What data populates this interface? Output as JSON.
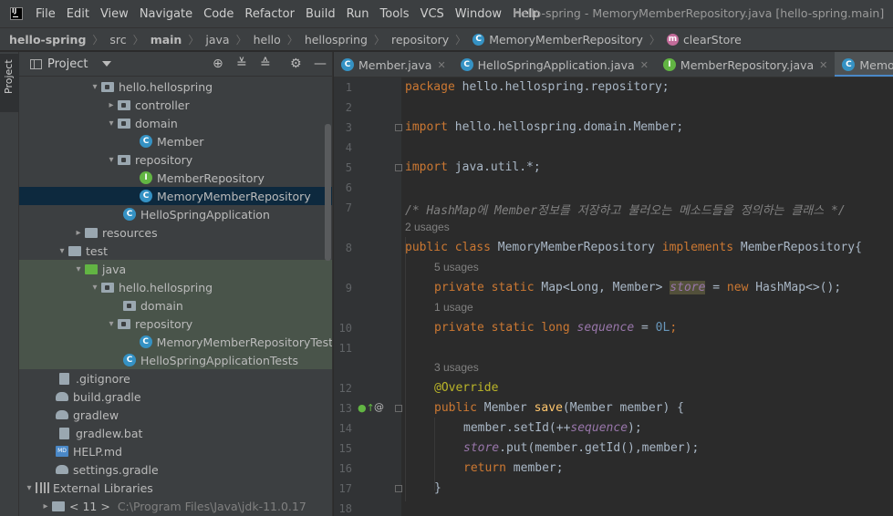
{
  "menu": {
    "items": [
      "File",
      "Edit",
      "View",
      "Navigate",
      "Code",
      "Refactor",
      "Build",
      "Run",
      "Tools",
      "VCS",
      "Window",
      "Help"
    ],
    "window_title": "hello-spring - MemoryMemberRepository.java [hello-spring.main]"
  },
  "breadcrumb": [
    "hello-spring",
    "src",
    "main",
    "java",
    "hello",
    "hellospring",
    "repository",
    "MemoryMemberRepository",
    "clearStore"
  ],
  "project_panel": {
    "title": "Project",
    "strip_label": "Project",
    "tree": [
      {
        "label": "hello.hellospring",
        "icon": "package-folder-icon"
      },
      {
        "label": "controller",
        "icon": "package-folder-icon"
      },
      {
        "label": "domain",
        "icon": "package-folder-icon"
      },
      {
        "label": "Member",
        "icon": "class-icon"
      },
      {
        "label": "repository",
        "icon": "package-folder-icon"
      },
      {
        "label": "MemberRepository",
        "icon": "interface-icon"
      },
      {
        "label": "MemoryMemberRepository",
        "icon": "class-icon"
      },
      {
        "label": "HelloSpringApplication",
        "icon": "spring-class-icon"
      },
      {
        "label": "resources",
        "icon": "resources-folder-icon"
      },
      {
        "label": "test",
        "icon": "folder-icon"
      },
      {
        "label": "java",
        "icon": "test-source-folder-icon"
      },
      {
        "label": "hello.hellospring",
        "icon": "package-folder-icon"
      },
      {
        "label": "domain",
        "icon": "package-folder-icon"
      },
      {
        "label": "repository",
        "icon": "package-folder-icon"
      },
      {
        "label": "MemoryMemberRepositoryTest",
        "icon": "test-class-icon"
      },
      {
        "label": "HelloSpringApplicationTests",
        "icon": "test-class-icon"
      },
      {
        "label": ".gitignore",
        "icon": "file-icon"
      },
      {
        "label": "build.gradle",
        "icon": "gradle-icon"
      },
      {
        "label": "gradlew",
        "icon": "gradle-icon"
      },
      {
        "label": "gradlew.bat",
        "icon": "file-icon"
      },
      {
        "label": "HELP.md",
        "icon": "markdown-icon"
      },
      {
        "label": "settings.gradle",
        "icon": "gradle-icon"
      },
      {
        "label": "External Libraries",
        "icon": "library-icon"
      },
      {
        "label": "< 11 >",
        "icon": "sdk-folder-icon",
        "extra": "C:\\Program Files\\Java\\jdk-11.0.17"
      }
    ]
  },
  "tabs": [
    {
      "label": "Member.java",
      "icon": "class-icon"
    },
    {
      "label": "HelloSpringApplication.java",
      "icon": "spring-class-icon"
    },
    {
      "label": "MemberRepository.java",
      "icon": "interface-icon"
    },
    {
      "label": "MemoryMemberRepository.java",
      "icon": "class-icon"
    }
  ],
  "editor": {
    "line_numbers": [
      "1",
      "2",
      "3",
      "4",
      "5",
      "6",
      "7",
      "8",
      "9",
      "10",
      "11",
      "12",
      "13",
      "14",
      "15",
      "16",
      "17",
      "18"
    ],
    "usages": [
      "2 usages",
      "5 usages",
      "1 usage",
      "3 usages"
    ],
    "lines": {
      "l1_kw": "package",
      "l1_rest": " hello.hellospring.repository;",
      "l3_kw": "import",
      "l3_rest": " hello.hellospring.domain.Member;",
      "l5_kw": "import",
      "l5_rest": " java.util.*;",
      "l7_comment": "/* HashMap에 Member정보를 저장하고 불러오는 메소드들을 정의하는 클래스 */",
      "l8_kw": "public class",
      "l8_name": " MemoryMemberRepository ",
      "l8_kw2": "implements",
      "l8_rest": " MemberRepository{",
      "l9_kw": "private static",
      "l9_type": " Map<Long, Member> ",
      "l9_field": "store",
      "l9_eq": " = ",
      "l9_new": "new",
      "l9_rest": " HashMap<>();",
      "l10_kw": "private static long",
      "l10_sp": " ",
      "l10_field": "sequence",
      "l10_eq": " = ",
      "l10_num": "0L",
      "l10_end": ";",
      "l12_ann": "@Override",
      "l13_kw": "public",
      "l13_type": " Member ",
      "l13_fn": "save",
      "l13_rest": "(Member member) {",
      "l14_pre": "member.setId(++",
      "l14_field": "sequence",
      "l14_post": ");",
      "l15_field": "store",
      "l15_rest": ".put(member.getId(),member);",
      "l16_kw": "return",
      "l16_rest": " member;",
      "l17": "}"
    }
  }
}
